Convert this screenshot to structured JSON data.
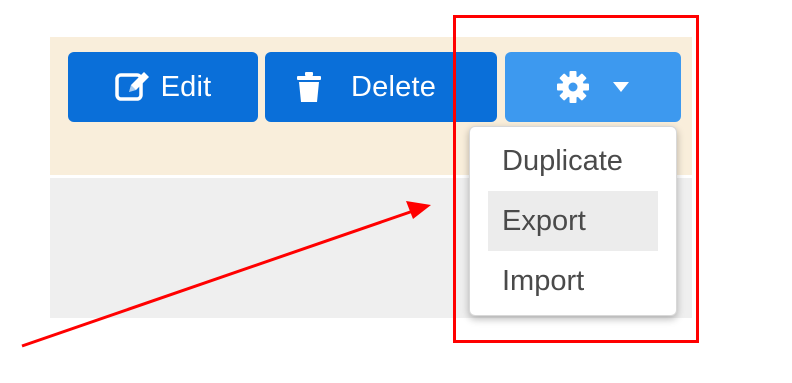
{
  "toolbar": {
    "edit_label": "Edit",
    "delete_label": "Delete",
    "edit_icon": "edit-icon",
    "delete_icon": "trash-icon",
    "settings_icon": "gear-icon",
    "dropdown_icon": "caret-down-icon"
  },
  "settings_menu": {
    "items": [
      {
        "label": "Duplicate",
        "highlighted": false
      },
      {
        "label": "Export",
        "highlighted": true
      },
      {
        "label": "Import",
        "highlighted": false
      }
    ]
  },
  "annotations": {
    "highlight_box_color": "#ff0000",
    "arrow_color": "#ff0000"
  },
  "colors": {
    "primary_button": "#0a6fd9",
    "settings_button": "#3d99ef",
    "toolbar_background": "#f9eedb",
    "panel_background": "#efefef",
    "menu_highlight": "#ececec"
  }
}
